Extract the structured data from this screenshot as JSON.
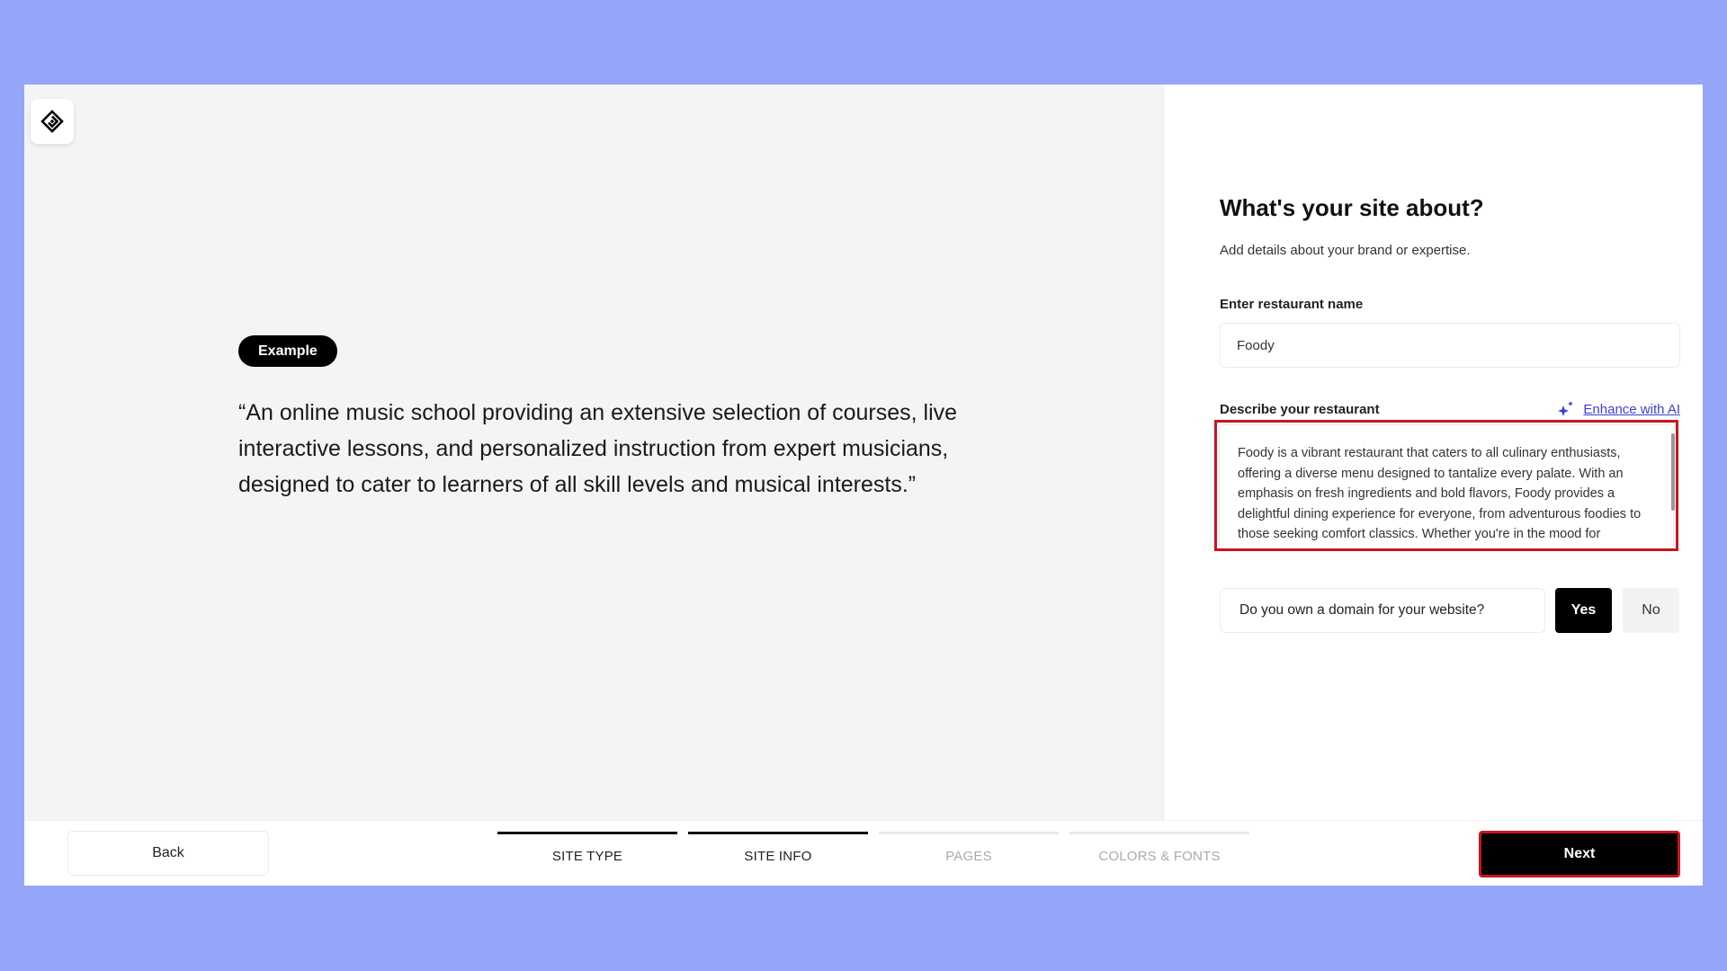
{
  "brand": {
    "logo_icon": "diamond-logo-icon"
  },
  "example": {
    "badge_label": "Example",
    "quote": "“An online music school providing an extensive selection of courses, live interactive lessons, and personalized instruction from expert musicians, designed to cater to learners of all skill levels and musical interests.”"
  },
  "form": {
    "title": "What's your site about?",
    "subtitle": "Add details about your brand or expertise.",
    "name_label": "Enter restaurant name",
    "name_value": "Foody",
    "description_label": "Describe your restaurant",
    "enhance_label": "Enhance with AI",
    "enhance_icon": "sparkle-icon",
    "description_value": "Foody is a vibrant restaurant that caters to all culinary enthusiasts, offering a diverse menu designed to tantalize every palate. With an emphasis on fresh ingredients and bold flavors, Foody provides a delightful dining experience for everyone, from adventurous foodies to those seeking comfort classics. Whether you're in the mood for international cuisine or local favorites, ...",
    "domain_question": "Do you own a domain for your website?",
    "yes_label": "Yes",
    "no_label": "No",
    "domain_selected": "Yes"
  },
  "footer": {
    "back_label": "Back",
    "next_label": "Next",
    "steps": [
      {
        "label": "SITE TYPE",
        "state": "done"
      },
      {
        "label": "SITE INFO",
        "state": "done"
      },
      {
        "label": "PAGES",
        "state": "pending"
      },
      {
        "label": "COLORS & FONTS",
        "state": "pending"
      }
    ]
  },
  "colors": {
    "background": "#95a6f8",
    "highlight": "#c8161e",
    "link": "#3b3fd6",
    "primary": "#000000"
  }
}
